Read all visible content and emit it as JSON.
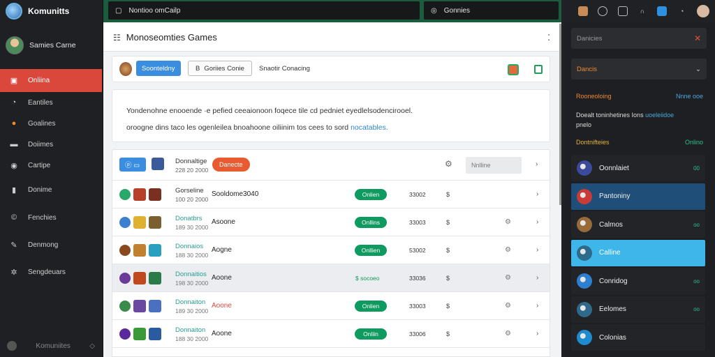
{
  "app": {
    "logo_text": "Komunitts"
  },
  "profile": {
    "name": "Samies Carne"
  },
  "nav": [
    {
      "label": "Onliina",
      "icon": "gamepad-icon",
      "glyph": "▣"
    },
    {
      "label": "Eantiles",
      "icon": "compass-icon",
      "glyph": "◔"
    },
    {
      "label": "Goalines",
      "icon": "circle-icon",
      "glyph": "●"
    },
    {
      "label": "Doiimes",
      "icon": "folder-icon",
      "glyph": "▬"
    },
    {
      "label": "Cartipe",
      "icon": "info-icon",
      "glyph": "◉"
    },
    {
      "label": "Donime",
      "icon": "chart-icon",
      "glyph": "▮"
    },
    {
      "label": "Fenchies",
      "icon": "copyright-icon",
      "glyph": "©"
    },
    {
      "label": "Denmong",
      "icon": "wrench-icon",
      "glyph": "✎"
    },
    {
      "label": "Sengdeuars",
      "icon": "settings-icon",
      "glyph": "✲"
    }
  ],
  "sidebar_footer": {
    "label": "Komuniites"
  },
  "topbar": {
    "search1": "Nontioo omCailp",
    "search2": "Gonnies"
  },
  "main": {
    "title": "Monoseomties Games",
    "toolbar": {
      "blue_button": "Soonteldny",
      "outline_button": "Goriies Conie",
      "text": "Snaotir Conacing"
    },
    "description": {
      "line1": "Yondenohne enooende ·e pefied ceeaionoon foqece tile cd pedniet eyedlelsodencirooel.",
      "line2_text": "oroogne dins taco les ogenleilea bnoahoone oiliinim tos cees to sord",
      "line2_link": "nocatables."
    },
    "list_header": {
      "name_line1": "Donnaltige",
      "name_line2": "228 20 2000",
      "red_button": "Danecte",
      "input_placeholder": "Nnlline"
    },
    "rows": [
      {
        "name": "Gorseline",
        "sub": "100 20 2000",
        "title": "Sooldome3040",
        "status": "Onlien",
        "status_style": "pill",
        "num": "33002",
        "cur": "$",
        "gear": false,
        "title_red": false,
        "highlight": false
      },
      {
        "name": "Donatbrs",
        "sub": "189 30 2000",
        "title": "Asoone",
        "status": "Onllins",
        "status_style": "pill",
        "num": "33003",
        "cur": "$",
        "gear": true,
        "title_red": false,
        "highlight": false
      },
      {
        "name": "Donnaios",
        "sub": "188 30 2000",
        "title": "Aogne",
        "status": "Onllien",
        "status_style": "pill",
        "num": "53002",
        "cur": "$",
        "gear": true,
        "title_red": false,
        "highlight": false
      },
      {
        "name": "Donnaitios",
        "sub": "198 30 2000",
        "title": "Aoone",
        "status": "$ socoeo",
        "status_style": "text",
        "num": "33036",
        "cur": "$",
        "gear": true,
        "title_red": false,
        "highlight": true
      },
      {
        "name": "Donnaiton",
        "sub": "189 30 2000",
        "title": "Aoone",
        "status": "Onlien",
        "status_style": "pill",
        "num": "33003",
        "cur": "$",
        "gear": true,
        "title_red": true,
        "highlight": false
      },
      {
        "name": "Donnaiton",
        "sub": "188 30 2000",
        "title": "Aoone",
        "status": "Onliin",
        "status_style": "pill",
        "num": "33006",
        "cur": "$",
        "gear": true,
        "title_red": false,
        "highlight": false
      }
    ]
  },
  "right_panel": {
    "search_placeholder": "Danicies",
    "select_value": "Dancis",
    "sec1_title": "Rooneoloing",
    "sec1_right": "Nnne ooe",
    "sec1_text_a": "Doealt toninhetines Ions",
    "sec1_text_b": "uoeleiidoe",
    "sec1_text_c": "pnelo",
    "sec2_title": "Dontnifteies",
    "sec2_right": "Onlino",
    "items": [
      {
        "label": "Oonnlaiet",
        "extra": "00",
        "icon": "planet-icon",
        "color": "#3b4a9a",
        "bg": "#222428",
        "text_color": "#eeeeee"
      },
      {
        "label": "Pantoniny",
        "extra": "",
        "icon": "card-icon",
        "color": "#c93b36",
        "bg": "#1f4f78",
        "text_color": "#eeeeee"
      },
      {
        "label": "Calmos",
        "extra": "oo",
        "icon": "hero-icon",
        "color": "#9a6b3a",
        "bg": "#222428",
        "text_color": "#eeeeee"
      },
      {
        "label": "Calline",
        "extra": "",
        "icon": "mage-icon",
        "color": "#2e6a8a",
        "bg": "#3fb6ea",
        "text_color": "#ffffff"
      },
      {
        "label": "Conridog",
        "extra": "oo",
        "icon": "globe-icon",
        "color": "#2d7fd0",
        "bg": "#222428",
        "text_color": "#eeeeee"
      },
      {
        "label": "Eelomes",
        "extra": "oo",
        "icon": "tower-icon",
        "color": "#2f6a8a",
        "bg": "#222428",
        "text_color": "#eeeeee"
      },
      {
        "label": "Colonias",
        "extra": "",
        "icon": "ring-icon",
        "color": "#1e8ad0",
        "bg": "#222428",
        "text_color": "#eeeeee"
      }
    ]
  }
}
